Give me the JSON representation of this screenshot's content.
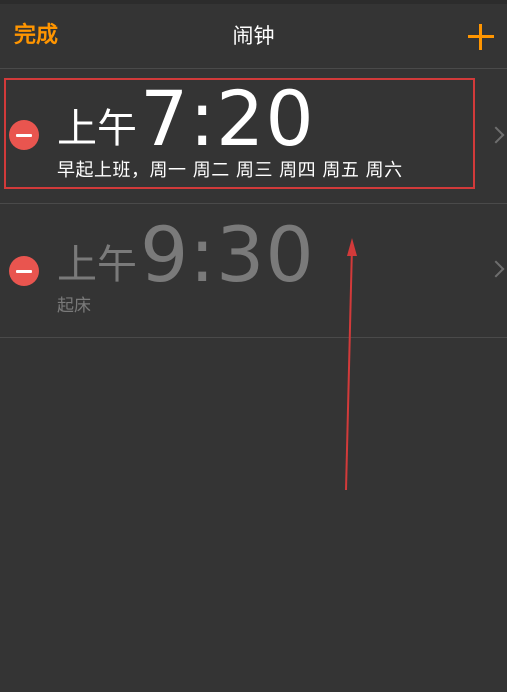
{
  "navbar": {
    "done_label": "完成",
    "title": "闹钟",
    "add_icon": "plus-icon"
  },
  "alarms": [
    {
      "ampm": "上午",
      "time": "7:20",
      "label": "早起上班，周一 周二 周三 周四 周五 周六",
      "enabled": true
    },
    {
      "ampm": "上午",
      "time": "9:30",
      "label": "起床",
      "enabled": false
    }
  ],
  "annotation": {
    "highlight_color": "#d23a3a",
    "arrow_color": "#d23a3a"
  },
  "colors": {
    "accent": "#ff9500",
    "delete": "#e9554f",
    "background": "#343434"
  }
}
